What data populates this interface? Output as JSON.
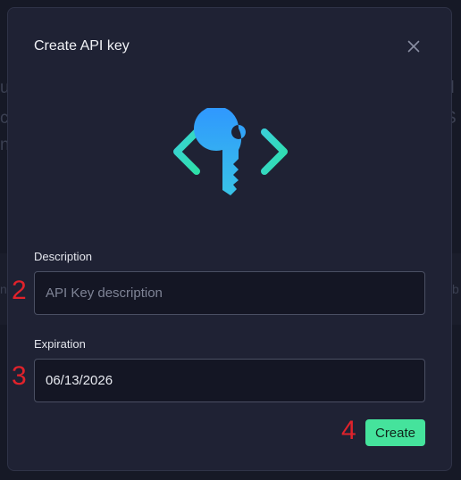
{
  "dialog": {
    "title": "Create API key",
    "close_icon": "close-icon",
    "hero_icon": "api-key-code-icon"
  },
  "form": {
    "description": {
      "label": "Description",
      "placeholder": "API Key description",
      "value": ""
    },
    "expiration": {
      "label": "Expiration",
      "value": "06/13/2026"
    },
    "create_label": "Create"
  },
  "annotations": {
    "description_marker": "2",
    "expiration_marker": "3",
    "create_marker": "4"
  },
  "colors": {
    "accent": "#45e39c",
    "marker": "#e0222b",
    "key_gradient_top": "#2f97ff",
    "key_gradient_bottom": "#39c3e6",
    "bracket": "#34d6c0"
  }
}
